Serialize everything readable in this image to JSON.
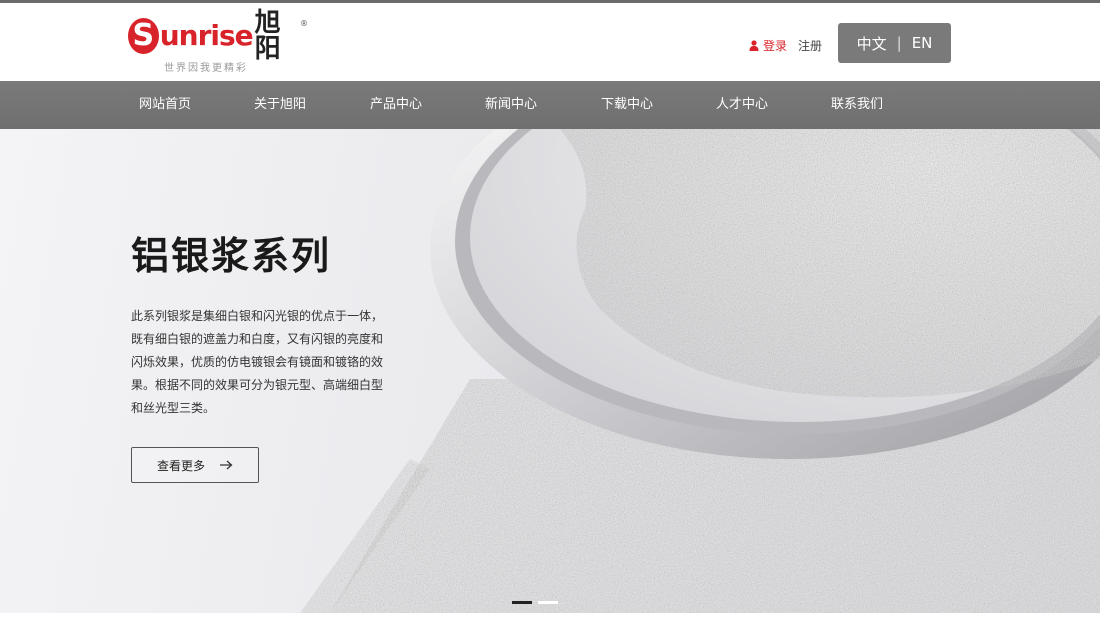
{
  "brand": {
    "logo_letter": "S",
    "logo_text": "unrise",
    "logo_cn": "旭阳",
    "logo_reg": "®",
    "slogan": "世界因我更精彩",
    "color": "#d8232a"
  },
  "header": {
    "login_label": "登录",
    "register_label": "注册",
    "lang_zh": "中文",
    "lang_sep": "|",
    "lang_en": "EN"
  },
  "nav": {
    "items": [
      {
        "label": "网站首页"
      },
      {
        "label": "关于旭阳"
      },
      {
        "label": "产品中心"
      },
      {
        "label": "新闻中心"
      },
      {
        "label": "下载中心"
      },
      {
        "label": "人才中心"
      },
      {
        "label": "联系我们"
      }
    ]
  },
  "hero": {
    "title": "铝银浆系列",
    "description": "此系列银浆是集细白银和闪光银的优点于一体，既有细白银的遮盖力和白度，又有闪银的亮度和闪烁效果，优质的仿电镀银会有镜面和镀铬的效果。根据不同的效果可分为银元型、高端细白型和丝光型三类。",
    "button_label": "查看更多",
    "slides_total": 2,
    "slide_active": 1
  },
  "icons": {
    "user": "user-icon",
    "arrow": "arrow-right-icon"
  }
}
